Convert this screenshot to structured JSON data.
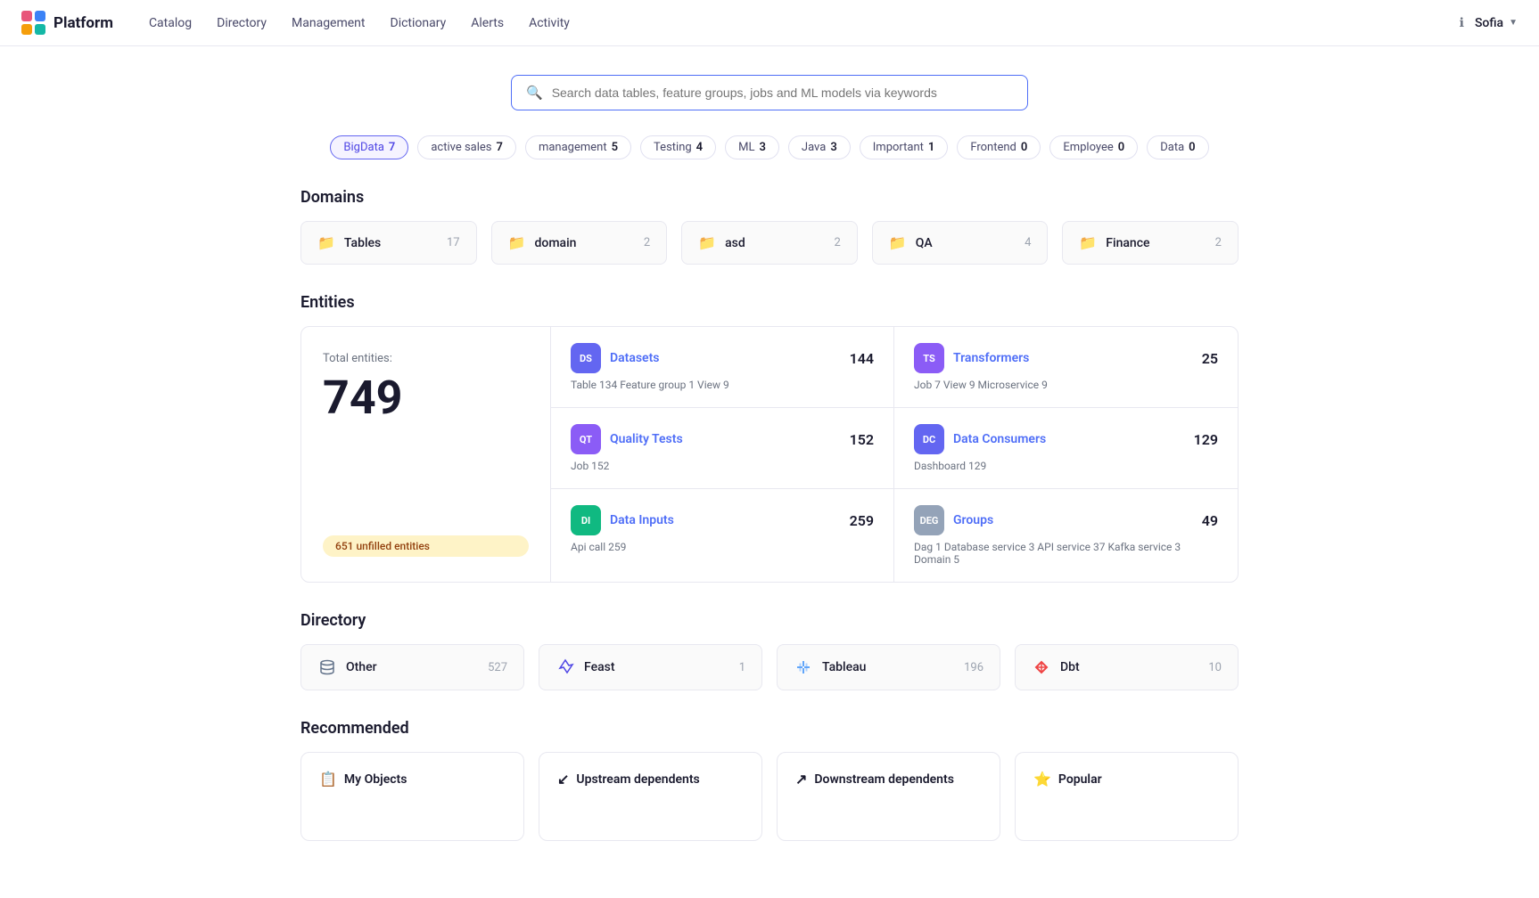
{
  "brand": {
    "name": "Platform"
  },
  "nav": {
    "links": [
      "Catalog",
      "Directory",
      "Management",
      "Dictionary",
      "Alerts",
      "Activity"
    ],
    "user": "Sofia"
  },
  "search": {
    "placeholder": "Search data tables, feature groups, jobs and ML models via keywords"
  },
  "tags": [
    {
      "label": "BigData",
      "count": "7",
      "active": true
    },
    {
      "label": "active sales",
      "count": "7",
      "active": false
    },
    {
      "label": "management",
      "count": "5",
      "active": false
    },
    {
      "label": "Testing",
      "count": "4",
      "active": false
    },
    {
      "label": "ML",
      "count": "3",
      "active": false
    },
    {
      "label": "Java",
      "count": "3",
      "active": false
    },
    {
      "label": "Important",
      "count": "1",
      "active": false
    },
    {
      "label": "Frontend",
      "count": "0",
      "active": false
    },
    {
      "label": "Employee",
      "count": "0",
      "active": false
    },
    {
      "label": "Data",
      "count": "0",
      "active": false
    }
  ],
  "domains": {
    "title": "Domains",
    "items": [
      {
        "name": "Tables",
        "count": 17
      },
      {
        "name": "domain",
        "count": 2
      },
      {
        "name": "asd",
        "count": 2
      },
      {
        "name": "QA",
        "count": 4
      },
      {
        "name": "Finance",
        "count": 2
      }
    ]
  },
  "entities": {
    "title": "Entities",
    "total_label": "Total entities:",
    "total": "749",
    "unfilled": "651 unfilled entities",
    "items": [
      {
        "badge": "DS",
        "badge_class": "badge-ds",
        "name": "Datasets",
        "count": 144,
        "meta": "Table 134   Feature group 1   View 9"
      },
      {
        "badge": "TS",
        "badge_class": "badge-ts",
        "name": "Transformers",
        "count": 25,
        "meta": "Job 7   View 9   Microservice 9"
      },
      {
        "badge": "QT",
        "badge_class": "badge-qt",
        "name": "Quality Tests",
        "count": 152,
        "meta": "Job 152"
      },
      {
        "badge": "DC",
        "badge_class": "badge-dc",
        "name": "Data Consumers",
        "count": 129,
        "meta": "Dashboard 129"
      },
      {
        "badge": "DI",
        "badge_class": "badge-di",
        "name": "Data Inputs",
        "count": 259,
        "meta": "Api call 259"
      },
      {
        "badge": "DEG",
        "badge_class": "badge-deg",
        "name": "Groups",
        "count": 49,
        "meta": "Dag 1   Database service 3   API service 37   Kafka service 3   Domain 5"
      }
    ]
  },
  "directory": {
    "title": "Directory",
    "items": [
      {
        "name": "Other",
        "count": 527,
        "icon": "db"
      },
      {
        "name": "Feast",
        "count": 1,
        "icon": "feast"
      },
      {
        "name": "Tableau",
        "count": 196,
        "icon": "tableau"
      },
      {
        "name": "Dbt",
        "count": 10,
        "icon": "dbt"
      }
    ]
  },
  "recommended": {
    "title": "Recommended",
    "items": [
      {
        "label": "My Objects",
        "icon": "📋"
      },
      {
        "label": "Upstream dependents",
        "icon": "↙"
      },
      {
        "label": "Downstream dependents",
        "icon": "↗"
      },
      {
        "label": "Popular",
        "icon": "⭐"
      }
    ]
  }
}
